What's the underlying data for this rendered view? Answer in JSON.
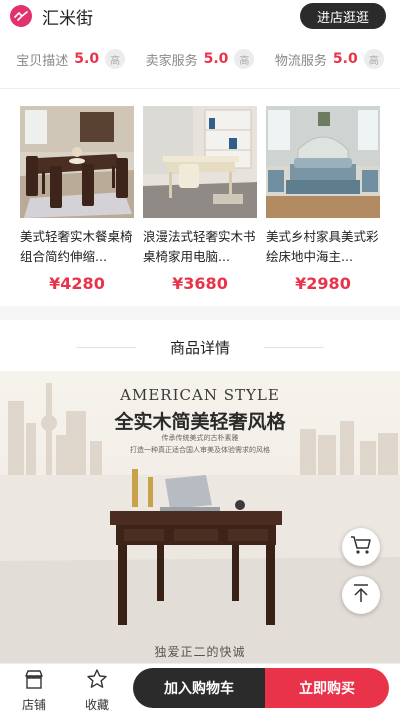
{
  "shop": {
    "name": "汇米街",
    "enter_label": "进店逛逛"
  },
  "ratings": [
    {
      "label": "宝贝描述",
      "score": "5.0",
      "badge": "高"
    },
    {
      "label": "卖家服务",
      "score": "5.0",
      "badge": "高"
    },
    {
      "label": "物流服务",
      "score": "5.0",
      "badge": "高"
    }
  ],
  "products": [
    {
      "title": "美式轻奢实木餐桌椅组合简约伸缩...",
      "price": "¥4280"
    },
    {
      "title": "浪漫法式轻奢实木书桌椅家用电脑...",
      "price": "¥3680"
    },
    {
      "title": "美式乡村家具美式彩绘床地中海主...",
      "price": "¥2980"
    }
  ],
  "detail": {
    "title": "商品详情"
  },
  "banner": {
    "en_title": "AMERICAN STYLE",
    "cn_title": "全实木简美轻奢风格",
    "sub1": "传承传统美式的古朴素雅",
    "sub2": "打造一种真正适合国人审美及体验需求的风格",
    "foot": "独爱正二的快诚"
  },
  "bottom": {
    "shop_label": "店铺",
    "fav_label": "收藏",
    "cart_label": "加入购物车",
    "buy_label": "立即购买"
  },
  "colors": {
    "accent": "#e8334b",
    "dark": "#2b2b2b",
    "logo": "#e0336b"
  }
}
